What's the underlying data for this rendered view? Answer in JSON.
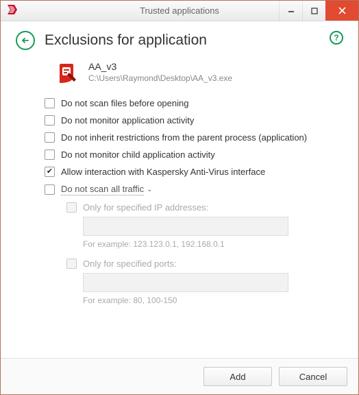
{
  "window": {
    "title": "Trusted applications"
  },
  "header": {
    "title": "Exclusions for application"
  },
  "app": {
    "name": "AA_v3",
    "path": "C:\\Users\\Raymond\\Desktop\\AA_v3.exe"
  },
  "checks": {
    "no_scan_open": {
      "label": "Do not scan files before opening",
      "checked": false
    },
    "no_monitor_activity": {
      "label": "Do not monitor application activity",
      "checked": false
    },
    "no_inherit": {
      "label": "Do not inherit restrictions from the parent process (application)",
      "checked": false
    },
    "no_monitor_child": {
      "label": "Do not monitor child application activity",
      "checked": false
    },
    "allow_interaction": {
      "label": "Allow interaction with Kaspersky Anti-Virus interface",
      "checked": true
    },
    "no_scan_traffic": {
      "label": "Do not scan all traffic",
      "checked": false
    }
  },
  "traffic": {
    "ip": {
      "label": "Only for specified IP addresses:",
      "value": "",
      "hint": "For example: 123.123.0.1, 192.168.0.1"
    },
    "ports": {
      "label": "Only for specified ports:",
      "value": "",
      "hint": "For example: 80, 100-150"
    }
  },
  "footer": {
    "add": "Add",
    "cancel": "Cancel"
  }
}
